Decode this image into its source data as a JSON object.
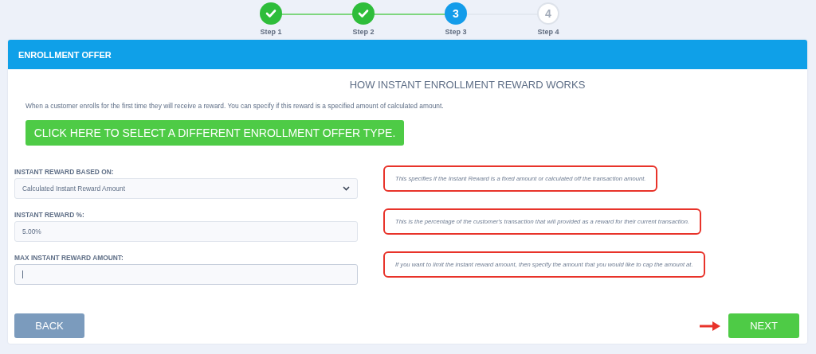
{
  "steps": [
    {
      "label": "Step 1",
      "completed": true,
      "selected": false
    },
    {
      "label": "Step 2",
      "completed": true,
      "selected": false
    },
    {
      "label": "Step 3",
      "number": "3",
      "completed": false,
      "selected": true
    },
    {
      "label": "Step 4",
      "number": "4",
      "completed": false,
      "selected": false
    }
  ],
  "card": {
    "header": "ENROLLMENT OFFER",
    "title": "HOW INSTANT ENROLLMENT REWARD WORKS",
    "description": "When a customer enrolls for the first time they will receive a reward. You can specify if this reward is a specified amount of calculated amount.",
    "offer_button": "CLICK HERE TO SELECT A DIFFERENT ENROLLMENT OFFER TYPE.",
    "fields": [
      {
        "kind": "select",
        "label": "INSTANT REWARD BASED ON:",
        "value": "Calculated Instant Reward Amount",
        "callout": "This specifies if the Instant Reward is a fixed amount or calculated off the transaction amount."
      },
      {
        "kind": "input",
        "label": "INSTANT REWARD %:",
        "value": "5.00%",
        "callout": "This is the percentage of the customer's transaction that will provided as a reward for their current transaction."
      },
      {
        "kind": "input",
        "label": "MAX INSTANT REWARD AMOUNT:",
        "focused": true,
        "callout": "If you want to limit the instant reward amount, then specify the amount that you would like to cap the amount at."
      }
    ],
    "back_button": "BACK",
    "next_button": "NEXT"
  }
}
